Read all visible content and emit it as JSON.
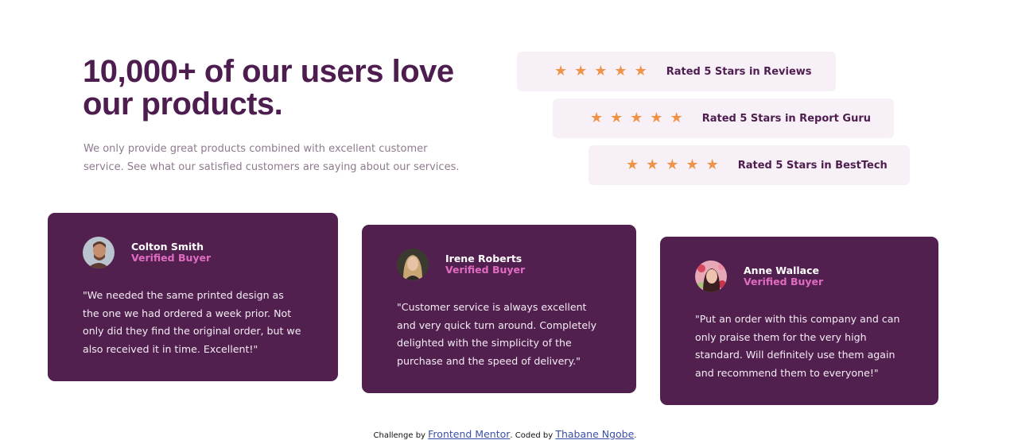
{
  "hero": {
    "title": "10,000+ of our users love our products.",
    "description": "We only provide great products combined with excellent customer service. See what our satisfied customers are saying about our services."
  },
  "ratings": [
    {
      "stars": 5,
      "label": "Rated 5 Stars in Reviews"
    },
    {
      "stars": 5,
      "label": "Rated 5 Stars in Report Guru"
    },
    {
      "stars": 5,
      "label": "Rated 5 Stars in BestTech"
    }
  ],
  "testimonials": [
    {
      "name": "Colton Smith",
      "status": "Verified Buyer",
      "quote": "\"We needed the same printed design as the one we had ordered a week prior. Not only did they find the original order, but we also received it in time. Excellent!\"",
      "avatar_icon": "avatar-colton-smith"
    },
    {
      "name": "Irene Roberts",
      "status": "Verified Buyer",
      "quote": "\"Customer service is always excellent and very quick turn around. Completely delighted with the simplicity of the purchase and the speed of delivery.\"",
      "avatar_icon": "avatar-irene-roberts"
    },
    {
      "name": "Anne Wallace",
      "status": "Verified Buyer",
      "quote": "\"Put an order with this company and can only praise them for the very high standard. Will definitely use them again and recommend them to everyone!\"",
      "avatar_icon": "avatar-anne-wallace"
    }
  ],
  "footer": {
    "challenge_prefix": "Challenge by",
    "challenge_link": "Frontend Mentor",
    "coded_prefix": ". Coded by",
    "coded_link": "Thabane Ngobe",
    "suffix": "."
  },
  "colors": {
    "primary": "#4e1d4f",
    "card_bg": "#52204f",
    "rating_bg": "#f7f1f7",
    "star": "#ee9347",
    "accent_pink": "#e06cc1",
    "body_text": "#8f7a8f"
  }
}
